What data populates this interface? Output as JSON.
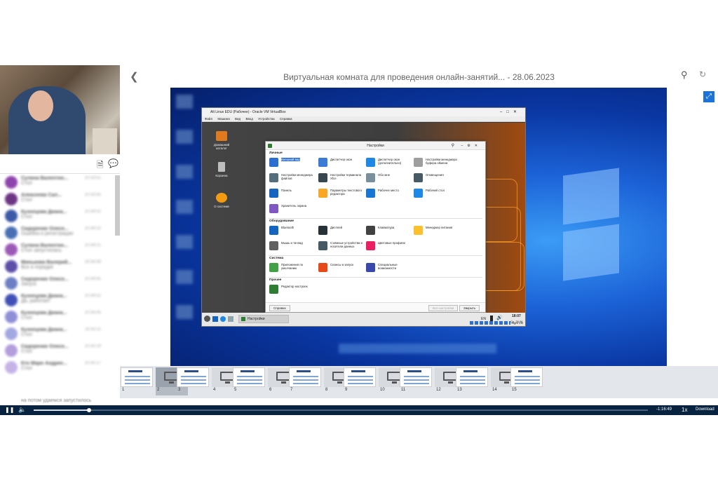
{
  "header": {
    "title": "Виртуальная комната для проведения онлайн-занятий... - 28.06.2023",
    "back_icon": "chevron-left-icon",
    "search_icon": "search-icon",
    "refresh_icon": "refresh-icon"
  },
  "chat": {
    "status_text": "на потом удаемся запустилось",
    "messages": [
      {
        "name": "Сулина Валентин...",
        "text": "Стол",
        "time": "10:33:51",
        "color": "#8e44ad"
      },
      {
        "name": "Алексеева Сал...",
        "text": "Стол",
        "time": "10:33:55",
        "color": "#6c3483"
      },
      {
        "name": "Кузнецова Диана...",
        "text": "Стол",
        "time": "10:34:02",
        "color": "#3c5aa6"
      },
      {
        "name": "Сидоренко Олеся...",
        "text": "Ошибка и регистрации",
        "time": "10:34:10",
        "color": "#4a6fb5"
      },
      {
        "name": "Сулина Валентин...",
        "text": "Стол запустилась",
        "time": "10:34:21",
        "color": "#9b59b6"
      },
      {
        "name": "Минькова Валерий...",
        "text": "Все в порядке",
        "time": "10:34:33",
        "color": "#5d4ea8"
      },
      {
        "name": "Сидоренко Олеся...",
        "text": "Запуск",
        "time": "10:34:41",
        "color": "#6d7fc2"
      },
      {
        "name": "Кузнецова Диана...",
        "text": "Да, работает",
        "time": "10:34:52",
        "color": "#3f51b5"
      },
      {
        "name": "Кузнецова Диана...",
        "text": "Стол",
        "time": "10:35:05",
        "color": "#8e8fd6"
      },
      {
        "name": "Кузнецова Диана...",
        "text": "Стол",
        "time": "10:35:11",
        "color": "#a3a8e0"
      },
      {
        "name": "Сидоренко Олеся...",
        "text": "Стол",
        "time": "10:35:19",
        "color": "#b39ddb"
      },
      {
        "name": "Кто Маро Андрее...",
        "text": "Стол",
        "time": "10:35:27",
        "color": "#c5b3e6"
      }
    ]
  },
  "vbox": {
    "title": "Alt Linux EDU (Рабочее) - Oracle VM VirtualBox",
    "menu": [
      "Файл",
      "Машина",
      "Вид",
      "Ввод",
      "Устройства",
      "Справка"
    ],
    "desktop_icons": [
      {
        "label": "Домашний каталог"
      },
      {
        "label": "Корзина"
      },
      {
        "label": "О системе"
      }
    ],
    "taskbar": {
      "app": "Настройки",
      "lang": "EN",
      "clock": "18:07",
      "date": "Ср, 28.06",
      "host_key": "Right Ctrl"
    }
  },
  "settings": {
    "title": "Настройки",
    "sections": [
      {
        "name": "Личные",
        "items": [
          {
            "label": "Внешний вид",
            "color": "#2d6fd1"
          },
          {
            "label": "Диспетчер окон",
            "color": "#3a7bd5"
          },
          {
            "label": "Диспетчер окон (дополнительно)",
            "color": "#1e88e5"
          },
          {
            "label": "Настройки менеджера буфера обмена",
            "color": "#9e9e9e"
          },
          {
            "label": "Настройки менеджера файлов",
            "color": "#546e7a"
          },
          {
            "label": "Настройки терминала Xfce",
            "color": "#37474f"
          },
          {
            "label": "Обо мне",
            "color": "#78909c"
          },
          {
            "label": "Оповещения",
            "color": "#455a64"
          },
          {
            "label": "Панель",
            "color": "#1565c0"
          },
          {
            "label": "Параметры текстового редактора",
            "color": "#f9a825"
          },
          {
            "label": "Рабочее место",
            "color": "#1976d2"
          },
          {
            "label": "Рабочий стол",
            "color": "#1e88e5"
          },
          {
            "label": "Хранитель экрана",
            "color": "#7e57c2"
          }
        ]
      },
      {
        "name": "Оборудование",
        "items": [
          {
            "label": "Bluetooth",
            "color": "#1565c0"
          },
          {
            "label": "Дисплей",
            "color": "#263238"
          },
          {
            "label": "Клавиатура",
            "color": "#424242"
          },
          {
            "label": "Менеджер питания",
            "color": "#fbc02d"
          },
          {
            "label": "Мышь и тачпад",
            "color": "#616161"
          },
          {
            "label": "Съёмные устройства и носители данных",
            "color": "#455a64"
          },
          {
            "label": "Цветовые профили",
            "color": "#e91e63"
          }
        ]
      },
      {
        "name": "Система",
        "items": [
          {
            "label": "Приложения по умолчанию",
            "color": "#43a047"
          },
          {
            "label": "Сеансы и запуск",
            "color": "#e64a19"
          },
          {
            "label": "Специальные возможности",
            "color": "#3949ab"
          }
        ]
      },
      {
        "name": "Прочее",
        "items": [
          {
            "label": "Редактор настроек",
            "color": "#2e7d32"
          }
        ]
      }
    ],
    "help_button": "Справка",
    "all_settings_button": "Все настройки",
    "close_button": "Закрыть"
  },
  "thumbnails": [
    {
      "num": "1",
      "type": "slide"
    },
    {
      "num": "2",
      "type": "screen",
      "selected": true
    },
    {
      "num": "3",
      "type": "slide"
    },
    {
      "num": "4",
      "type": "screen"
    },
    {
      "num": "5",
      "type": "slide"
    },
    {
      "num": "6",
      "type": "screen"
    },
    {
      "num": "7",
      "type": "slide"
    },
    {
      "num": "8",
      "type": "screen"
    },
    {
      "num": "9",
      "type": "slide"
    },
    {
      "num": "10",
      "type": "screen"
    },
    {
      "num": "11",
      "type": "slide"
    },
    {
      "num": "12",
      "type": "screen"
    },
    {
      "num": "13",
      "type": "slide"
    },
    {
      "num": "14",
      "type": "screen"
    },
    {
      "num": "15",
      "type": "slide"
    }
  ],
  "player": {
    "time_remaining": "-1:16:49",
    "speed": "1x",
    "download": "Download",
    "progress": 0.09
  }
}
